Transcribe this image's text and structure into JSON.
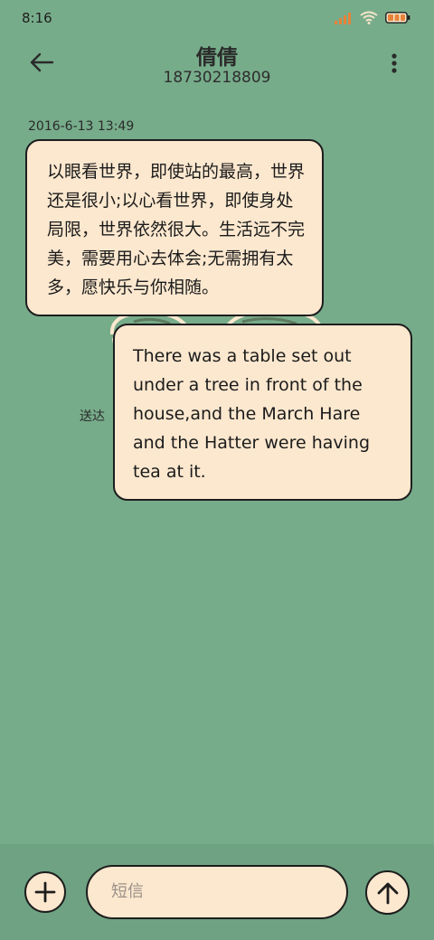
{
  "status_bar": {
    "time": "8:16"
  },
  "header": {
    "contact_name": "倩倩",
    "contact_number": "18730218809"
  },
  "conversation": {
    "timestamp": "2016-6-13 13:49",
    "messages": [
      {
        "direction": "incoming",
        "text": "以眼看世界，即使站的最高，世界还是很小;以心看世界，即使身处局限，世界依然很大。生活远不完美，需要用心去体会;无需拥有太多，愿快乐与你相随。"
      },
      {
        "direction": "outgoing",
        "text": "There was a table set out under a tree in front of the house,and the March Hare and the Hatter were having tea at it."
      }
    ],
    "status_label": "送达"
  },
  "composer": {
    "placeholder": "短信"
  },
  "colors": {
    "background": "#77ac8a",
    "bubble": "#fce8cf",
    "outline": "#1d1d1d",
    "signal": "#e8813a"
  },
  "icons": {
    "back": "arrow-left",
    "more": "more-vertical",
    "attach": "plus",
    "send": "arrow-up",
    "signal": "signal-bars",
    "wifi": "wifi",
    "battery": "battery"
  }
}
